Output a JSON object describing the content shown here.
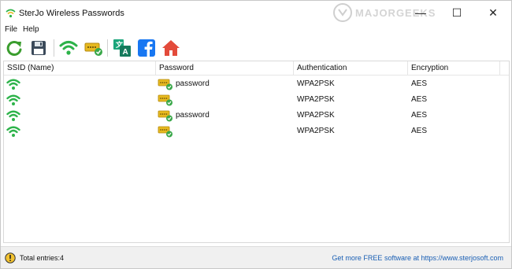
{
  "window": {
    "title": "SterJo Wireless Passwords",
    "watermark": "MAJORGEEKS",
    "minimize_glyph": "—",
    "maximize_glyph": "☐",
    "close_glyph": "✕"
  },
  "menu": {
    "file": "File",
    "help": "Help"
  },
  "toolbar": {
    "buttons": [
      {
        "icon": "refresh-icon",
        "color": "#3a9d2e"
      },
      {
        "icon": "save-icon",
        "color": "#3b4a5a"
      },
      {
        "icon": "wifi-icon",
        "color": "#2db34a"
      },
      {
        "icon": "password-key-icon",
        "color": "#e7b91f"
      },
      {
        "icon": "translate-icon",
        "color": "#1aa57a"
      },
      {
        "icon": "facebook-icon",
        "color": "#1877f2"
      },
      {
        "icon": "home-icon",
        "color": "#e34b3b"
      }
    ]
  },
  "list": {
    "columns": {
      "ssid": "SSID (Name)",
      "password": "Password",
      "authentication": "Authentication",
      "encryption": "Encryption"
    },
    "rows": [
      {
        "ssid": "",
        "password": "password",
        "authentication": "WPA2PSK",
        "encryption": "AES"
      },
      {
        "ssid": "",
        "password": "",
        "authentication": "WPA2PSK",
        "encryption": "AES"
      },
      {
        "ssid": "",
        "password": "password",
        "authentication": "WPA2PSK",
        "encryption": "AES"
      },
      {
        "ssid": "",
        "password": "",
        "authentication": "WPA2PSK",
        "encryption": "AES"
      }
    ]
  },
  "status": {
    "entries": "Total entries:4",
    "link": "Get more FREE software at https://www.sterjosoft.com"
  },
  "colors": {
    "wifi_green": "#2db34a",
    "key_yellow": "#e7b91f",
    "link_blue": "#1a5fb4"
  }
}
